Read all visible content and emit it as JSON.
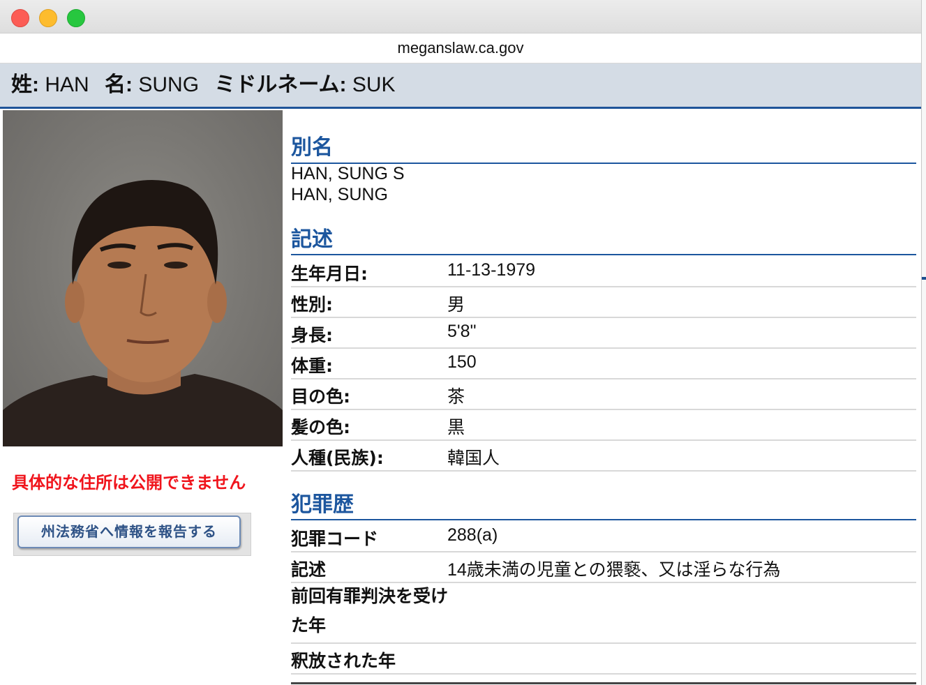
{
  "browser": {
    "url": "meganslaw.ca.gov"
  },
  "name_bar": {
    "last_label": "姓:",
    "last_value": "HAN",
    "first_label": "名:",
    "first_value": "SUNG",
    "middle_label": "ミドルネーム:",
    "middle_value": "SUK"
  },
  "left": {
    "warning": "具体的な住所は公開できません",
    "report_button": "州法務省へ情報を報告する"
  },
  "aliases": {
    "heading": "別名",
    "items": [
      "HAN, SUNG S",
      "HAN, SUNG"
    ]
  },
  "description": {
    "heading": "記述",
    "rows": [
      {
        "label": "生年月日:",
        "value": "11-13-1979"
      },
      {
        "label": "性別:",
        "value": "男"
      },
      {
        "label": "身長:",
        "value": "5'8\""
      },
      {
        "label": "体重:",
        "value": "150"
      },
      {
        "label": "目の色:",
        "value": "茶"
      },
      {
        "label": "髪の色:",
        "value": "黒"
      },
      {
        "label": "人種(民族):",
        "value": "韓国人"
      }
    ]
  },
  "offenses": {
    "heading": "犯罪歴",
    "rows": [
      {
        "label": "犯罪コード",
        "value": "288(a)"
      },
      {
        "label": "記述",
        "value": "14歳未満の児童との猥褻、又は淫らな行為"
      },
      {
        "label": "前回有罪判決を受けた年",
        "value": ""
      },
      {
        "label": "釈放された年",
        "value": ""
      }
    ]
  }
}
